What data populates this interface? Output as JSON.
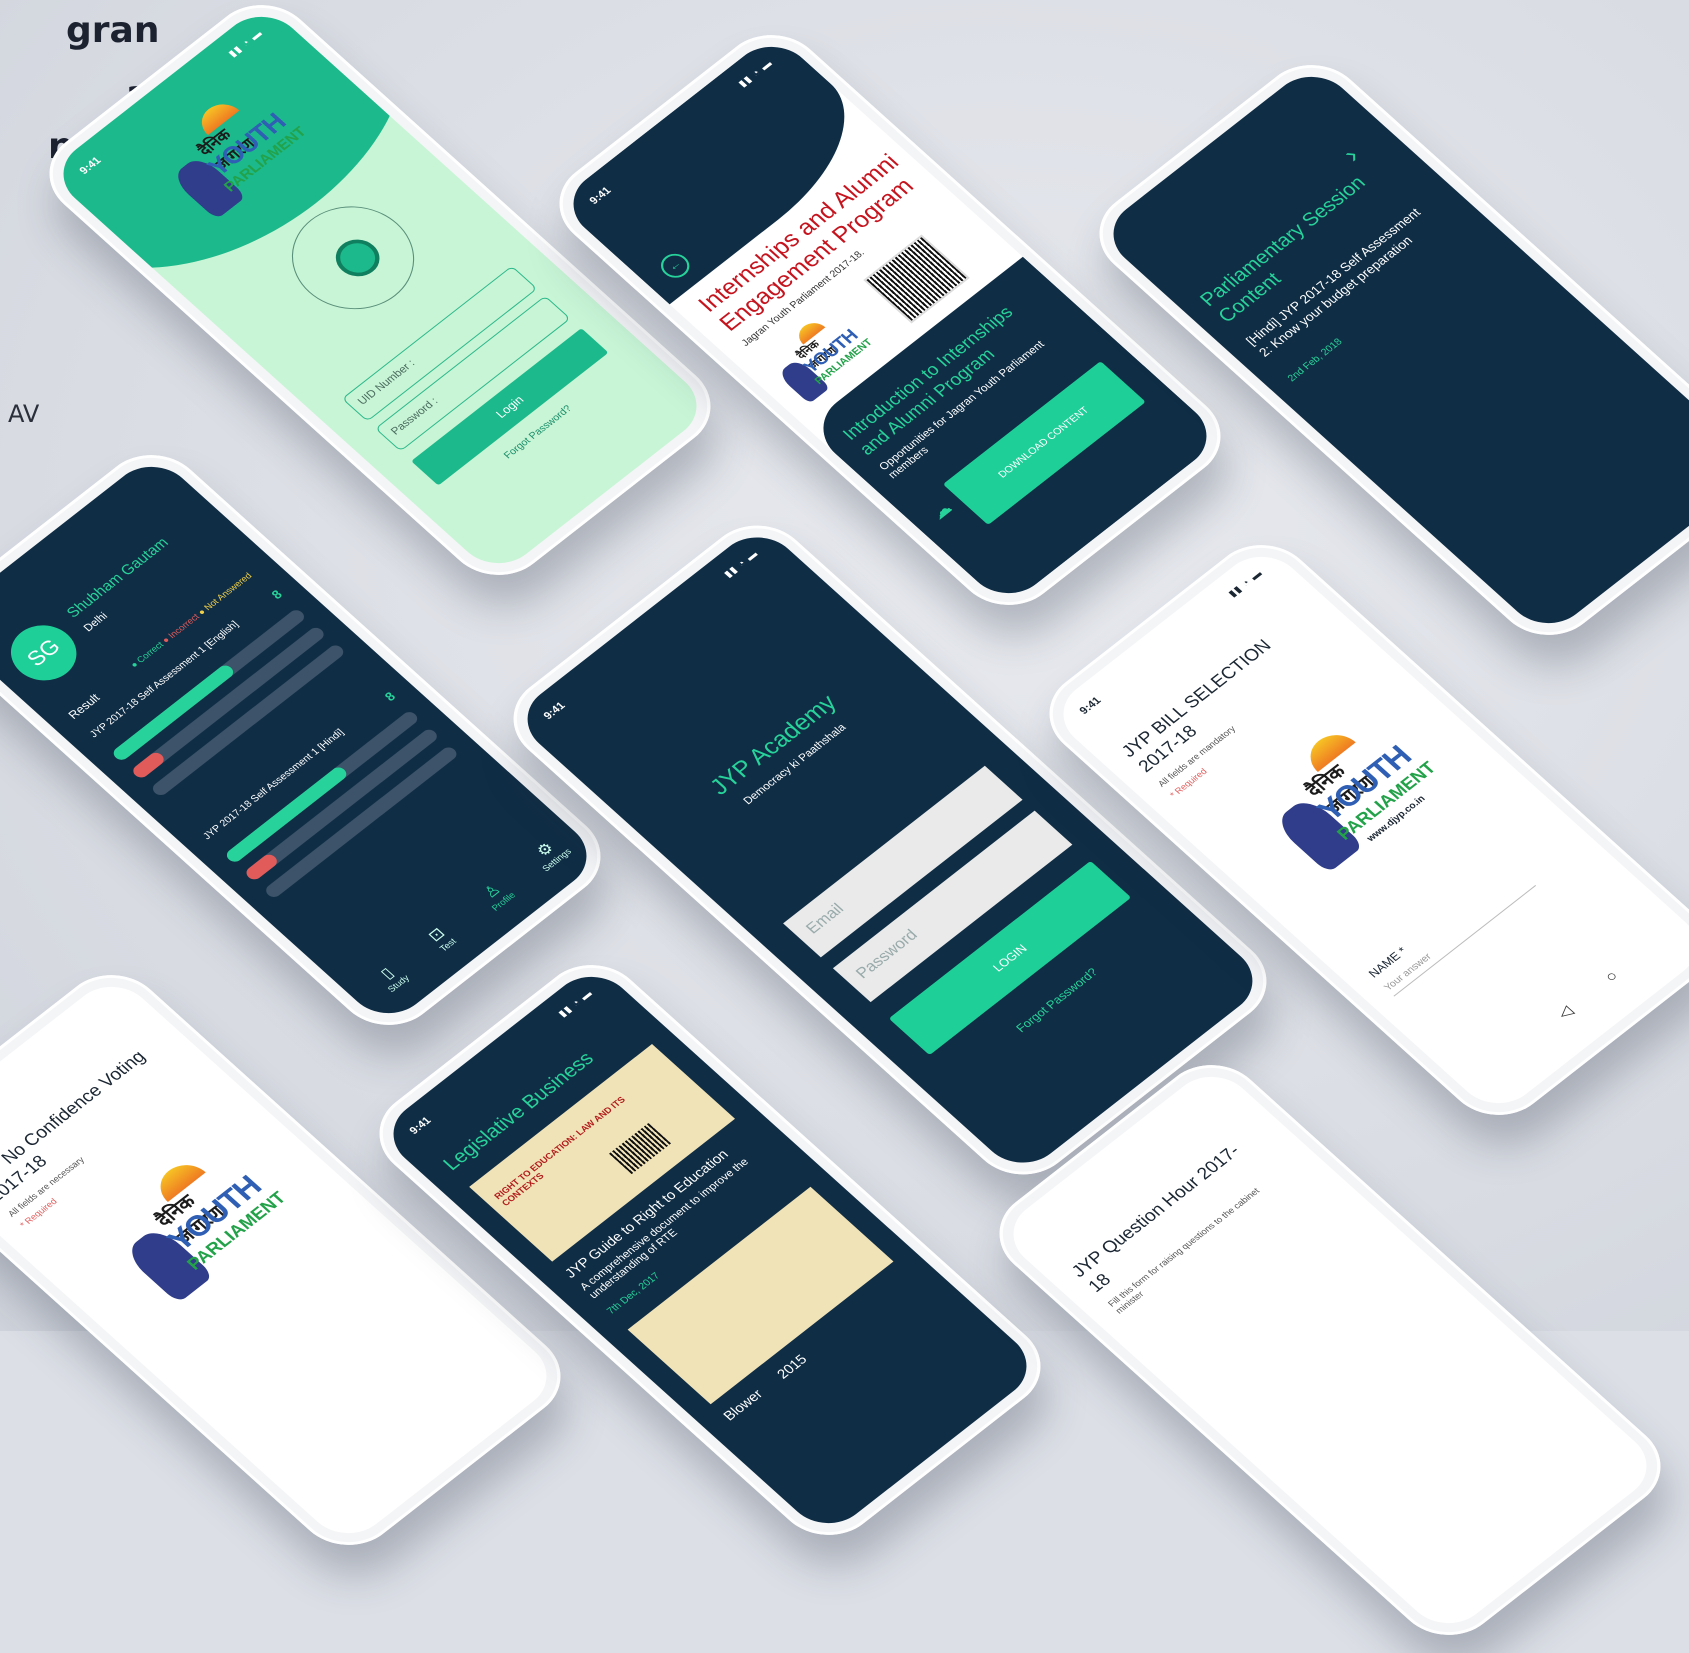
{
  "headline": {
    "line1": "gran",
    "line2": "a",
    "line3": "nt with"
  },
  "side_text": "AV",
  "status": {
    "time": "9:41"
  },
  "login_mint": {
    "uid_placeholder": "UID Number :",
    "password_placeholder": "Password :",
    "login_label": "Login",
    "forgot_label": "Forgot Password?"
  },
  "logo": {
    "hindi": "दैनिक जागरण",
    "youth": "YOUTH",
    "parliament": "PARLIAMENT",
    "site": "www.djyp.co.in"
  },
  "internships": {
    "title": "Internships and Alumni Engagement Program",
    "subtitle": "Jagran Youth Parliament 2017-18.",
    "intro_title": "Introduction to Internships and Alumni Program",
    "intro_desc": "Opportunities for Jagran Youth Parliament members",
    "download_label": "DOWNLOAD CONTENT"
  },
  "session": {
    "title": "Parliamentary Session Content",
    "item": "[Hindi] JYP 2017-18 Self Assessment 2: Know your budget preparation",
    "date": "2nd Feb, 2018"
  },
  "result": {
    "avatar": "SG",
    "name": "Shubham Gautam",
    "city": "Delhi",
    "section": "Result",
    "legend": {
      "correct": "Correct",
      "incorrect": "Incorrect",
      "not_answered": "Not Answered"
    },
    "tests": [
      {
        "name": "JYP 2017-18 Self Assessment 1 [English]",
        "score": "8",
        "correct": 0.62,
        "incorrect": 0.14
      },
      {
        "name": "JYP 2017-18 Self Assessment 1 [Hindi]",
        "score": "8",
        "correct": 0.62,
        "incorrect": 0.14
      }
    ],
    "nav": {
      "study": "Study",
      "test": "Test",
      "profile": "Profile",
      "settings": "Settings"
    }
  },
  "academy": {
    "title": "JYP Academy",
    "subtitle": "Democracy ki Paathshala",
    "email_placeholder": "Email",
    "password_placeholder": "Password",
    "login_label": "LOGIN",
    "forgot_label": "Forgot Password?"
  },
  "bill": {
    "title": "JYP BILL SELECTION 2017-18",
    "note": "All fields are mandatory",
    "required": "* Required",
    "name_label": "NAME *",
    "answer_placeholder": "Your answer"
  },
  "noconf": {
    "title": "JYP No Confidence Voting 2017-18",
    "note": "All fields are necessary",
    "required": "* Required"
  },
  "legis": {
    "title": "Legislative Business",
    "doc_heading": "RIGHT TO EDUCATION: LAW AND ITS CONTEXTS",
    "item_title": "JYP Guide to Right to Education",
    "item_desc": "A comprehensive document to improve the understanding of RTE",
    "item_date": "7th Dec, 2017",
    "item2_title": "Blower",
    "item2_date": "2015"
  },
  "question": {
    "title": "JYP Question Hour 2017-18",
    "desc": "Fill this form for raising questions to the cabinet minister"
  },
  "colors": {
    "navy": "#0f2d45",
    "green": "#1fcf98",
    "mint": "#c8f5d6",
    "red": "#e25b5b",
    "yellow": "#f2d14a"
  }
}
